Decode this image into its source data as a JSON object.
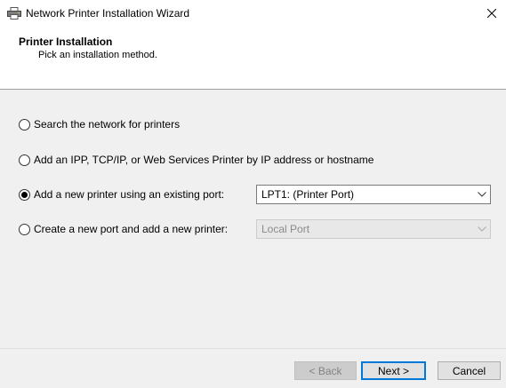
{
  "window": {
    "title": "Network Printer Installation Wizard",
    "icon": "printer-icon",
    "close_icon": "close-icon"
  },
  "header": {
    "title": "Printer Installation",
    "subtitle": "Pick an installation method."
  },
  "options": [
    {
      "label": "Search the network for printers",
      "selected": false
    },
    {
      "label": "Add an IPP, TCP/IP, or Web Services Printer by IP address or hostname",
      "selected": false
    },
    {
      "label": "Add a new printer using an existing port:",
      "selected": true
    },
    {
      "label": "Create a new port and add a new printer:",
      "selected": false
    }
  ],
  "existing_port_select": {
    "value": "LPT1: (Printer Port)",
    "enabled": true
  },
  "new_port_select": {
    "value": "Local Port",
    "enabled": false
  },
  "buttons": {
    "back": "< Back",
    "next": "Next >",
    "cancel": "Cancel"
  },
  "colors": {
    "default_button_border": "#0078d7",
    "window_bg": "#f0f0f0",
    "header_bg": "#ffffff"
  }
}
